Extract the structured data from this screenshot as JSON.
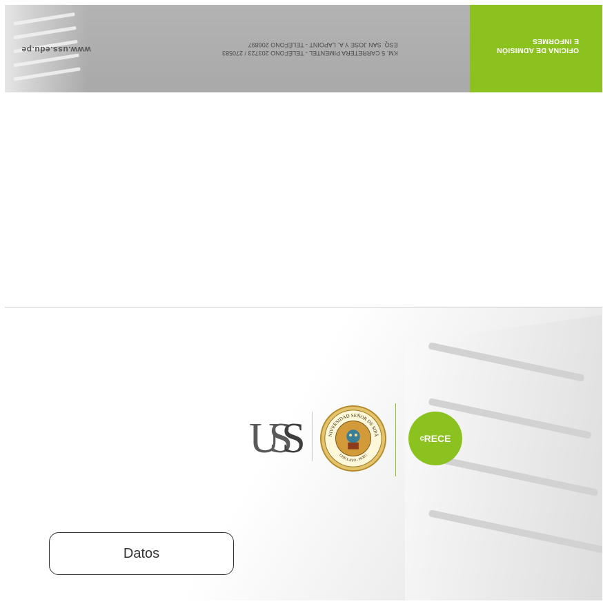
{
  "banner": {
    "office_title_line1": "OFICINA DE ADMISIÓN",
    "office_title_line2": "E INFORMES",
    "address_line1": "KM. 5 CARRETERA PIMENTEL - TELÉFONO 203723 / 270583",
    "address_line2": "ESQ. SAN JOSE Y A. LAPOINT - TELÉFONO 206897",
    "website": "www.uss.edu.pe",
    "colors": {
      "green": "#8cc21f",
      "gray": "#b0b0b0"
    }
  },
  "logos": {
    "uss_letters": "US",
    "seal_text_top": "UNIVERSIDAD SEÑOR DE SIPÁN",
    "seal_text_bottom": "CHICLAYO - PERÚ",
    "crece_prefix": "c",
    "crece_text": "RECE"
  },
  "form": {
    "label": "Datos"
  }
}
